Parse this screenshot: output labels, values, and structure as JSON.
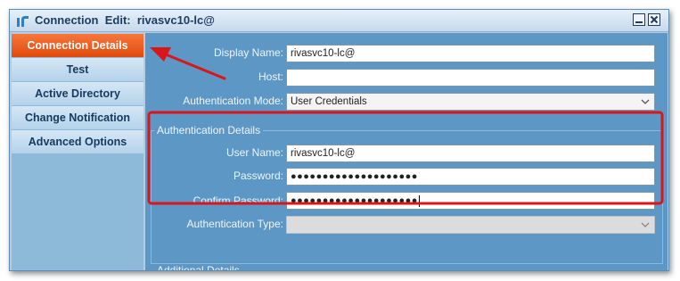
{
  "window": {
    "title": "Connection  Edit:  rivasvc10-lc@",
    "icons": {
      "app": "app-logo-icon",
      "minimize": "minimize-icon",
      "close": "close-icon"
    }
  },
  "sidebar": {
    "items": [
      {
        "label": "Connection Details",
        "active": true
      },
      {
        "label": "Test",
        "active": false
      },
      {
        "label": "Active Directory",
        "active": false
      },
      {
        "label": "Change Notification",
        "active": false
      },
      {
        "label": "Advanced Options",
        "active": false
      }
    ]
  },
  "form": {
    "display_name": {
      "label": "Display Name:",
      "value": "rivasvc10-lc@"
    },
    "host": {
      "label": "Host:",
      "value": ""
    },
    "auth_mode": {
      "label": "Authentication Mode:",
      "value": "User Credentials"
    },
    "auth_details": {
      "legend": "Authentication Details",
      "user_name": {
        "label": "User Name:",
        "value": "rivasvc10-lc@"
      },
      "password": {
        "label": "Password:",
        "value": "●●●●●●●●●●●●●●●●●●●●"
      },
      "confirm_password": {
        "label": "Confirm Password:",
        "value": "●●●●●●●●●●●●●●●●●●●●"
      },
      "auth_type": {
        "label": "Authentication Type:",
        "value": ""
      }
    },
    "additional": {
      "legend": "Additional Details"
    }
  },
  "annotations": {
    "highlight_color": "#d9161a",
    "arrow_color": "#d9161a"
  },
  "colors": {
    "active_tab": "#ef5e20",
    "panel": "#5c97c5",
    "sidebar": "#8dbad9"
  }
}
